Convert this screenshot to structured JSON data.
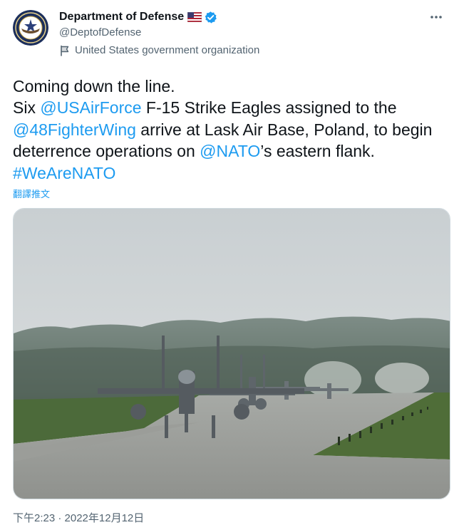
{
  "author": {
    "display_name": "Department of Defense",
    "handle": "@DeptofDefense",
    "affiliation": "United States government organization",
    "avatar_icon": "dod-seal-icon",
    "flag_icon": "us-flag-icon",
    "verified_icon": "verified-badge-icon"
  },
  "tweet": {
    "line1": "Coming down the line.",
    "seg_six": "Six ",
    "mention_usaf": "@USAirForce",
    "seg_f15": " F-15 Strike Eagles assigned to the",
    "mention_48fw": "@48FighterWing",
    "seg_arrive": " arrive at Lask Air Base, Poland, to begin deterrence operations on ",
    "mention_nato": "@NATO",
    "seg_flank": "’s eastern flank. ",
    "hashtag": "#WeAreNATO"
  },
  "translate_label": "翻譯推文",
  "timestamp": "下午2:23 · 2022年12月12日",
  "colors": {
    "link": "#1d9bf0",
    "secondary_text": "#536471",
    "primary_text": "#0f1419"
  }
}
